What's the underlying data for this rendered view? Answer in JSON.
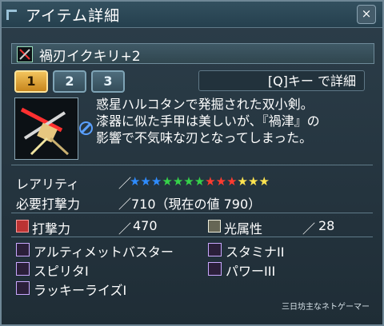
{
  "window": {
    "title": "アイテム詳細",
    "close_label": "×"
  },
  "item": {
    "name": "禍刃イクキリ+2"
  },
  "tabs": [
    {
      "label": "1",
      "active": true
    },
    {
      "label": "2",
      "active": false
    },
    {
      "label": "3",
      "active": false
    }
  ],
  "hint": "[Q]キー で詳細",
  "description": [
    "惑星ハルコタンで発掘された双小剣。",
    "漆器に似た手甲は美しいが、『禍津』の",
    "影響で不気味な刃となってしまった。"
  ],
  "rarity": {
    "label": "レアリティ",
    "stars": 13,
    "colors": [
      "#2f8cff",
      "#2f8cff",
      "#2f8cff",
      "#36d24a",
      "#36d24a",
      "#36d24a",
      "#36d24a",
      "#ff3b2f",
      "#ff3b2f",
      "#ff3b2f",
      "#ffe450",
      "#ffe450",
      "#ffe450"
    ]
  },
  "required": {
    "label": "必要打撃力",
    "sep": "／",
    "value": "710（現在の値 790）"
  },
  "stats": {
    "attack": {
      "label": "打撃力",
      "sep": "／",
      "value": "470"
    },
    "element": {
      "label": "光属性",
      "sep": "／",
      "value": "28"
    }
  },
  "abilities": [
    "アルティメットバスター",
    "スタミナII",
    "スピリタI",
    "パワーIII",
    "ラッキーライズI"
  ],
  "watermark": "三日坊主なネトゲーマー"
}
